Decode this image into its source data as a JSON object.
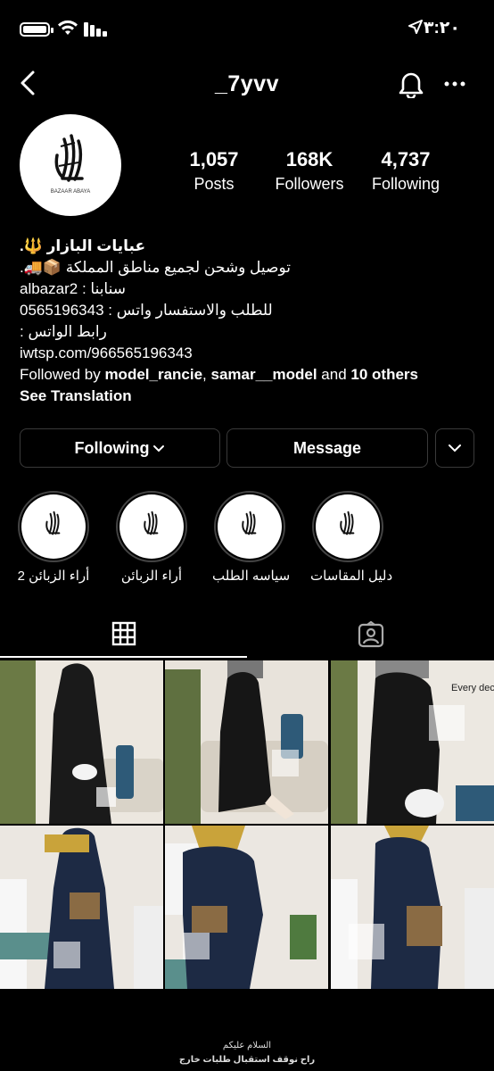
{
  "status_bar": {
    "time": "٣:٢٠"
  },
  "header": {
    "username": "_7yvv"
  },
  "profile": {
    "stats": [
      {
        "value": "1,057",
        "label": "Posts"
      },
      {
        "value": "168K",
        "label": "Followers"
      },
      {
        "value": "4,737",
        "label": "Following"
      }
    ],
    "bio": {
      "name": "عبايات البازار 🔱.",
      "line1": "توصيل وشحن لجميع مناطق المملكة 📦🚚.",
      "line2": "سنابنا : albazar2",
      "line3": "للطلب والاستفسار واتس : 0565196343",
      "line4": "رابط الواتس :",
      "link": "iwtsp.com/966565196343",
      "followed_prefix": "Followed by ",
      "followed_user1": "model_rancie",
      "followed_sep": ", ",
      "followed_user2": "samar__model",
      "followed_and": " and ",
      "followed_others": "10 others",
      "see_translation": "See Translation"
    }
  },
  "actions": {
    "following_label": "Following",
    "message_label": "Message"
  },
  "highlights": [
    {
      "label": "أراء الزبائن 2"
    },
    {
      "label": "أراء الزبائن"
    },
    {
      "label": "سياسه الطلب"
    },
    {
      "label": "دليل المقاسات"
    }
  ],
  "logo_text": "BAZAAR ABAYA",
  "post_text": "Every deci",
  "footer": {
    "line1": "السلام عليكم",
    "line2": "راح نوقف استقبال طلبات خارج"
  },
  "colors": {
    "background": "#000000",
    "border": "#3a3a3a",
    "text": "#ffffff"
  }
}
